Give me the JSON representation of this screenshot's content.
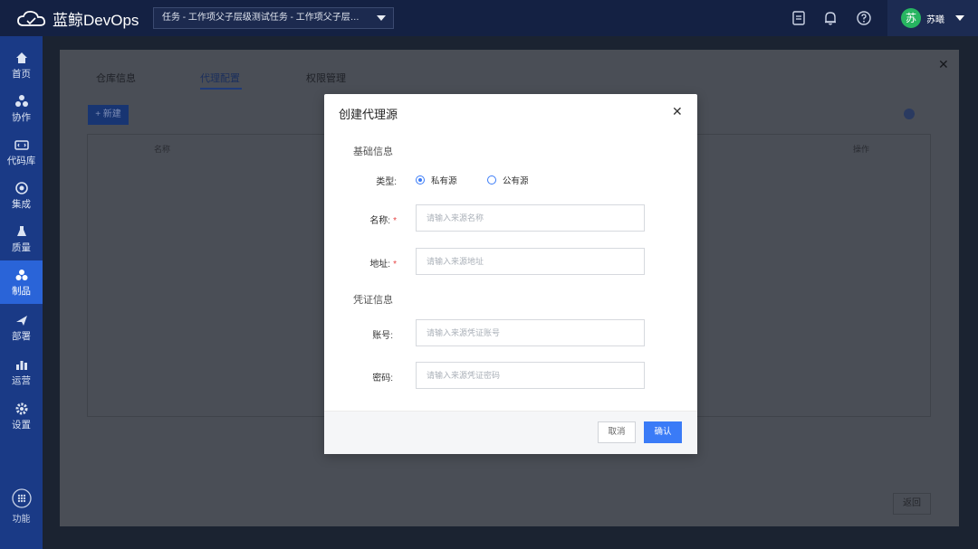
{
  "app": {
    "name": "蓝鲸DevOps"
  },
  "header": {
    "project_select": "任务 - 工作项父子层级测试任务 - 工作项父子层级测…",
    "user_avatar": "苏",
    "user_name": "苏曦"
  },
  "sidebar": {
    "items": [
      {
        "label": "首页",
        "icon": "home-icon"
      },
      {
        "label": "协作",
        "icon": "collab-icon"
      },
      {
        "label": "代码库",
        "icon": "code-icon"
      },
      {
        "label": "集成",
        "icon": "integration-icon"
      },
      {
        "label": "质量",
        "icon": "quality-icon"
      },
      {
        "label": "制品",
        "icon": "artifact-icon",
        "active": true
      },
      {
        "label": "部署",
        "icon": "deploy-icon"
      },
      {
        "label": "运营",
        "icon": "ops-icon"
      },
      {
        "label": "设置",
        "icon": "settings-icon"
      }
    ],
    "bottom_label": "功能"
  },
  "background_page": {
    "tabs": [
      "仓库信息",
      "代理配置",
      "权限管理"
    ],
    "active_tab": "代理配置",
    "add_button": "+ 新建",
    "columns": [
      "名称",
      "操作"
    ],
    "hint": "[unclear]",
    "footer_button": "返回"
  },
  "modal": {
    "title": "创建代理源",
    "section_basic": "基础信息",
    "type_label": "类型:",
    "type_options": [
      "私有源",
      "公有源"
    ],
    "type_selected": "私有源",
    "name_label": "名称:",
    "name_placeholder": "请输入来源名称",
    "url_label": "地址:",
    "url_placeholder": "请输入来源地址",
    "section_credential": "凭证信息",
    "account_label": "账号:",
    "account_placeholder": "请输入来源凭证账号",
    "password_label": "密码:",
    "password_placeholder": "请输入来源凭证密码",
    "cancel": "取消",
    "confirm": "确认"
  },
  "colors": {
    "accent": "#3a7bf7",
    "sidebar_bg": "#1a3a86",
    "sidebar_active": "#2a64d8",
    "topbar_bg": "#142143",
    "avatar_bg": "#27b561"
  }
}
